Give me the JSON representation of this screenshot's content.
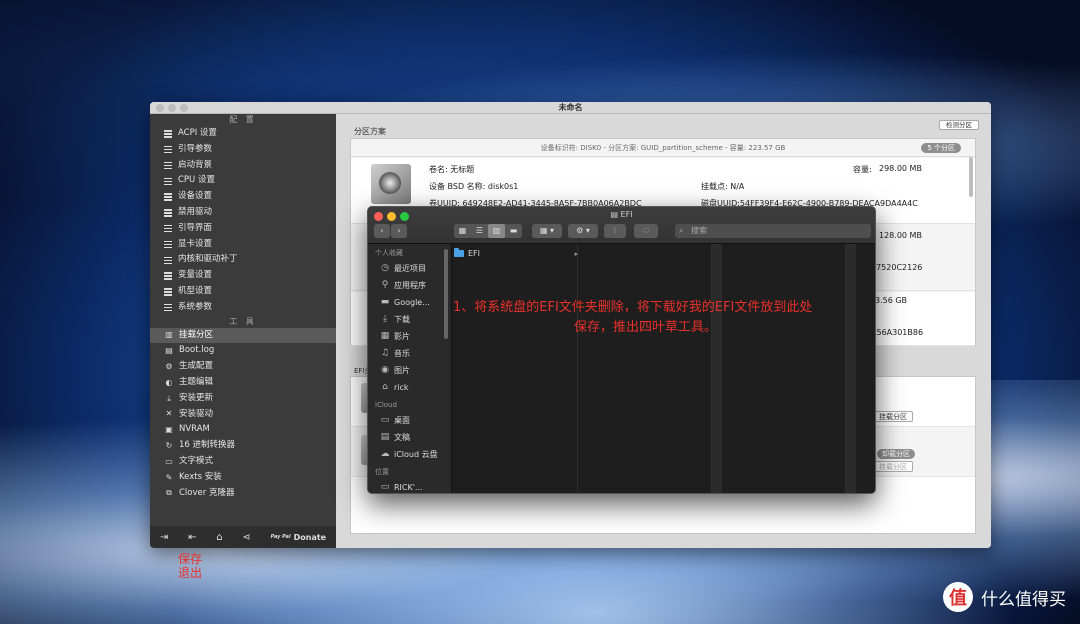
{
  "window": {
    "title": "未命名"
  },
  "sidebar": {
    "section_config": "配 置",
    "config_items": [
      "ACPI 设置",
      "引导参数",
      "启动背景",
      "CPU 设置",
      "设备设置",
      "禁用驱动",
      "引导界面",
      "显卡设置",
      "内核和驱动补丁",
      "变量设置",
      "机型设置",
      "系统参数"
    ],
    "section_tools": "工 具",
    "tool_items": [
      {
        "label": "挂载分区",
        "icon": "disk-icon"
      },
      {
        "label": "Boot.log",
        "icon": "document-icon"
      },
      {
        "label": "生成配置",
        "icon": "gears-icon"
      },
      {
        "label": "主题编辑",
        "icon": "palette-icon"
      },
      {
        "label": "安装更新",
        "icon": "download-icon"
      },
      {
        "label": "安装驱动",
        "icon": "tools-icon"
      },
      {
        "label": "NVRAM",
        "icon": "chip-icon"
      },
      {
        "label": "16 进制转换器",
        "icon": "refresh-icon"
      },
      {
        "label": "文字模式",
        "icon": "text-icon"
      },
      {
        "label": "Kexts 安装",
        "icon": "wrench-icon"
      },
      {
        "label": "Clover 克隆器",
        "icon": "clone-icon"
      }
    ],
    "donate_small": "Pay Pal",
    "donate": "Donate"
  },
  "main": {
    "partition_scheme_label": "分区方案",
    "detect_button": "检测分区",
    "disk_header": "设备标识符: DISK0 - 分区方案: GUID_partition_scheme - 容量: 223.57 GB",
    "partition_count": "5 个分区",
    "volume": {
      "name": "卷名: 无标题",
      "capacity_label": "容量:",
      "capacity": "298.00 MB",
      "bsd": "设备 BSD 名称: disk0s1",
      "mount": "挂载点: N/A",
      "uuid": "卷UUID: 649248E2-AD41-3445-8A5F-7BB0A06A2BDC",
      "disk_uuid": "磁盘UUID:54FF39F4-E62C-4900-B789-DEACA9DA4A4C"
    },
    "partial_values": [
      "128.00 MB",
      "37520C2126",
      "3.56 GB",
      "A56A301B86"
    ],
    "efi_label": "EFI分",
    "mount_button": "挂载分区",
    "unmount_button": "卸载分区",
    "mount_button2": "挂载分区"
  },
  "finder": {
    "title": "EFI",
    "search_placeholder": "搜索",
    "sections": {
      "favorites": "个人收藏",
      "icloud": "iCloud",
      "locations": "位置"
    },
    "favorites": [
      {
        "label": "最近项目",
        "icon": "clock-icon"
      },
      {
        "label": "应用程序",
        "icon": "apps-icon"
      },
      {
        "label": "Google...",
        "icon": "folder-icon"
      },
      {
        "label": "下载",
        "icon": "download-icon"
      },
      {
        "label": "影片",
        "icon": "film-icon"
      },
      {
        "label": "音乐",
        "icon": "music-icon"
      },
      {
        "label": "图片",
        "icon": "camera-icon"
      },
      {
        "label": "rick",
        "icon": "home-icon"
      }
    ],
    "icloud": [
      {
        "label": "桌面",
        "icon": "desktop-icon"
      },
      {
        "label": "文稿",
        "icon": "doc-icon"
      },
      {
        "label": "iCloud 云盘",
        "icon": "cloud-icon"
      }
    ],
    "location_partial": "RICK'...",
    "folder": "EFI"
  },
  "annotations": {
    "instruction_line1": "1、将系统盘的EFI文件夹删除，将下载好我的EFI文件放到此处",
    "instruction_line2": "保存，推出四叶草工具。",
    "save_exit": "保存\n退出"
  },
  "watermark": {
    "logo_char": "值",
    "text": "什么值得买"
  },
  "colors": {
    "annotation": "#e8302a",
    "finder_bg": "#1e1e1e",
    "sidebar_bg": "#3b3b3b"
  }
}
